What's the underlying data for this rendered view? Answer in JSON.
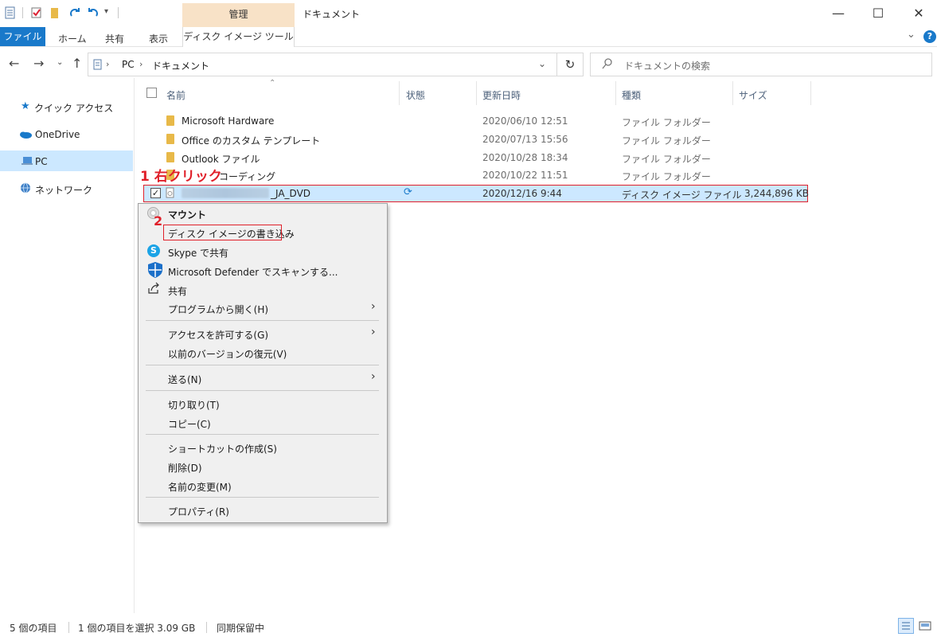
{
  "window": {
    "title": "ドキュメント",
    "contextual_group": "管理",
    "minimize": "—",
    "maximize": "☐",
    "close": "✕"
  },
  "ribbon": {
    "tabs": [
      "ファイル",
      "ホーム",
      "共有",
      "表示",
      "ディスク イメージ ツール"
    ],
    "help": "?"
  },
  "address": {
    "crumbs": [
      "PC",
      "ドキュメント"
    ],
    "search_placeholder": "ドキュメントの検索"
  },
  "nav": {
    "items": [
      "クイック アクセス",
      "OneDrive",
      "PC",
      "ネットワーク"
    ]
  },
  "columns": [
    "名前",
    "状態",
    "更新日時",
    "種類",
    "サイズ"
  ],
  "files": [
    {
      "name": "Microsoft Hardware",
      "date": "2020/06/10 12:51",
      "type": "ファイル フォルダー",
      "size": ""
    },
    {
      "name": "Office のカスタム テンプレート",
      "date": "2020/07/13 15:56",
      "type": "ファイル フォルダー",
      "size": ""
    },
    {
      "name": "Outlook ファイル",
      "date": "2020/10/28 18:34",
      "type": "ファイル フォルダー",
      "size": ""
    },
    {
      "name": "コーディング",
      "date": "2020/10/22 11:51",
      "type": "ファイル フォルダー",
      "size": ""
    },
    {
      "name": "_JA_DVD",
      "date": "2020/12/16 9:44",
      "type": "ディスク イメージ ファイル",
      "size": "3,244,896 KB"
    }
  ],
  "context_menu": {
    "items": [
      "マウント",
      "ディスク イメージの書き込み",
      "Skype で共有",
      "Microsoft Defender でスキャンする...",
      "共有",
      "プログラムから開く(H)",
      "アクセスを許可する(G)",
      "以前のバージョンの復元(V)",
      "送る(N)",
      "切り取り(T)",
      "コピー(C)",
      "ショートカットの作成(S)",
      "削除(D)",
      "名前の変更(M)",
      "プロパティ(R)"
    ]
  },
  "annotations": {
    "step1_num": "1",
    "step1_text": "右クリック",
    "step2_num": "2"
  },
  "status": {
    "count": "5 個の項目",
    "selected": "1 個の項目を選択  3.09 GB",
    "sync": "同期保留中"
  },
  "colors": {
    "accent": "#1979ca",
    "selection": "#cce8ff",
    "annotation_red": "#e0202a",
    "contextual_tab": "#f8e2c7"
  }
}
